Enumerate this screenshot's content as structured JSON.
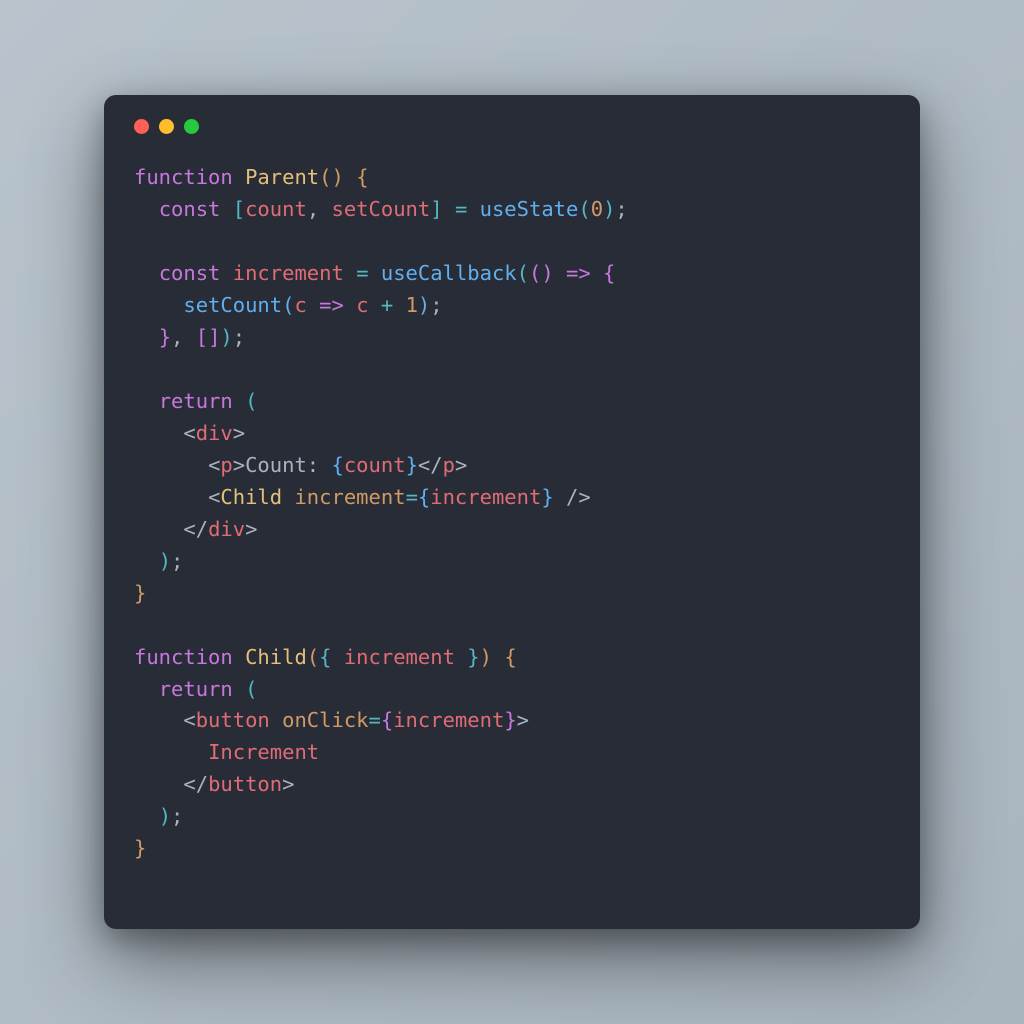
{
  "tokens": [
    [
      {
        "t": "function",
        "c": "kw"
      },
      {
        "t": " ",
        "c": "punc"
      },
      {
        "t": "Parent",
        "c": "fn"
      },
      {
        "t": "(",
        "c": "paren"
      },
      {
        "t": ")",
        "c": "paren"
      },
      {
        "t": " ",
        "c": "punc"
      },
      {
        "t": "{",
        "c": "paren"
      }
    ],
    [
      {
        "t": "  ",
        "c": "punc"
      },
      {
        "t": "const",
        "c": "kw"
      },
      {
        "t": " ",
        "c": "punc"
      },
      {
        "t": "[",
        "c": "bracket"
      },
      {
        "t": "count",
        "c": "var"
      },
      {
        "t": ",",
        "c": "punc"
      },
      {
        "t": " ",
        "c": "punc"
      },
      {
        "t": "setCount",
        "c": "var"
      },
      {
        "t": "]",
        "c": "bracket"
      },
      {
        "t": " ",
        "c": "punc"
      },
      {
        "t": "=",
        "c": "op"
      },
      {
        "t": " ",
        "c": "punc"
      },
      {
        "t": "useState",
        "c": "fn2"
      },
      {
        "t": "(",
        "c": "bracket"
      },
      {
        "t": "0",
        "c": "num"
      },
      {
        "t": ")",
        "c": "bracket"
      },
      {
        "t": ";",
        "c": "punc"
      }
    ],
    [],
    [
      {
        "t": "  ",
        "c": "punc"
      },
      {
        "t": "const",
        "c": "kw"
      },
      {
        "t": " ",
        "c": "punc"
      },
      {
        "t": "increment",
        "c": "var"
      },
      {
        "t": " ",
        "c": "punc"
      },
      {
        "t": "=",
        "c": "op"
      },
      {
        "t": " ",
        "c": "punc"
      },
      {
        "t": "useCallback",
        "c": "fn2"
      },
      {
        "t": "(",
        "c": "bracket"
      },
      {
        "t": "(",
        "c": "brace2"
      },
      {
        "t": ")",
        "c": "brace2"
      },
      {
        "t": " ",
        "c": "punc"
      },
      {
        "t": "=>",
        "c": "kw"
      },
      {
        "t": " ",
        "c": "punc"
      },
      {
        "t": "{",
        "c": "brace2"
      }
    ],
    [
      {
        "t": "    ",
        "c": "punc"
      },
      {
        "t": "setCount",
        "c": "fn2"
      },
      {
        "t": "(",
        "c": "brace3"
      },
      {
        "t": "c",
        "c": "var"
      },
      {
        "t": " ",
        "c": "punc"
      },
      {
        "t": "=>",
        "c": "kw"
      },
      {
        "t": " ",
        "c": "punc"
      },
      {
        "t": "c",
        "c": "var"
      },
      {
        "t": " ",
        "c": "punc"
      },
      {
        "t": "+",
        "c": "op"
      },
      {
        "t": " ",
        "c": "punc"
      },
      {
        "t": "1",
        "c": "num"
      },
      {
        "t": ")",
        "c": "brace3"
      },
      {
        "t": ";",
        "c": "punc"
      }
    ],
    [
      {
        "t": "  ",
        "c": "punc"
      },
      {
        "t": "}",
        "c": "brace2"
      },
      {
        "t": ",",
        "c": "punc"
      },
      {
        "t": " ",
        "c": "punc"
      },
      {
        "t": "[",
        "c": "brace2"
      },
      {
        "t": "]",
        "c": "brace2"
      },
      {
        "t": ")",
        "c": "bracket"
      },
      {
        "t": ";",
        "c": "punc"
      }
    ],
    [],
    [
      {
        "t": "  ",
        "c": "punc"
      },
      {
        "t": "return",
        "c": "kw"
      },
      {
        "t": " ",
        "c": "punc"
      },
      {
        "t": "(",
        "c": "bracket"
      }
    ],
    [
      {
        "t": "    ",
        "c": "punc"
      },
      {
        "t": "<",
        "c": "tagb"
      },
      {
        "t": "div",
        "c": "tag"
      },
      {
        "t": ">",
        "c": "tagb"
      }
    ],
    [
      {
        "t": "      ",
        "c": "punc"
      },
      {
        "t": "<",
        "c": "tagb"
      },
      {
        "t": "p",
        "c": "tag"
      },
      {
        "t": ">",
        "c": "tagb"
      },
      {
        "t": "Count: ",
        "c": "txt"
      },
      {
        "t": "{",
        "c": "brace3"
      },
      {
        "t": "count",
        "c": "var"
      },
      {
        "t": "}",
        "c": "brace3"
      },
      {
        "t": "</",
        "c": "tagb"
      },
      {
        "t": "p",
        "c": "tag"
      },
      {
        "t": ">",
        "c": "tagb"
      }
    ],
    [
      {
        "t": "      ",
        "c": "punc"
      },
      {
        "t": "<",
        "c": "tagb"
      },
      {
        "t": "Child",
        "c": "fn"
      },
      {
        "t": " ",
        "c": "punc"
      },
      {
        "t": "increment",
        "c": "attr"
      },
      {
        "t": "=",
        "c": "op"
      },
      {
        "t": "{",
        "c": "brace3"
      },
      {
        "t": "increment",
        "c": "var"
      },
      {
        "t": "}",
        "c": "brace3"
      },
      {
        "t": " ",
        "c": "punc"
      },
      {
        "t": "/>",
        "c": "tagb"
      }
    ],
    [
      {
        "t": "    ",
        "c": "punc"
      },
      {
        "t": "</",
        "c": "tagb"
      },
      {
        "t": "div",
        "c": "tag"
      },
      {
        "t": ">",
        "c": "tagb"
      }
    ],
    [
      {
        "t": "  ",
        "c": "punc"
      },
      {
        "t": ")",
        "c": "bracket"
      },
      {
        "t": ";",
        "c": "punc"
      }
    ],
    [
      {
        "t": "}",
        "c": "paren"
      }
    ],
    [],
    [
      {
        "t": "function",
        "c": "kw"
      },
      {
        "t": " ",
        "c": "punc"
      },
      {
        "t": "Child",
        "c": "fn"
      },
      {
        "t": "(",
        "c": "paren"
      },
      {
        "t": "{",
        "c": "bracket"
      },
      {
        "t": " ",
        "c": "punc"
      },
      {
        "t": "increment",
        "c": "var"
      },
      {
        "t": " ",
        "c": "punc"
      },
      {
        "t": "}",
        "c": "bracket"
      },
      {
        "t": ")",
        "c": "paren"
      },
      {
        "t": " ",
        "c": "punc"
      },
      {
        "t": "{",
        "c": "paren"
      }
    ],
    [
      {
        "t": "  ",
        "c": "punc"
      },
      {
        "t": "return",
        "c": "kw"
      },
      {
        "t": " ",
        "c": "punc"
      },
      {
        "t": "(",
        "c": "bracket"
      }
    ],
    [
      {
        "t": "    ",
        "c": "punc"
      },
      {
        "t": "<",
        "c": "tagb"
      },
      {
        "t": "button",
        "c": "tag"
      },
      {
        "t": " ",
        "c": "punc"
      },
      {
        "t": "onClick",
        "c": "attr"
      },
      {
        "t": "=",
        "c": "op"
      },
      {
        "t": "{",
        "c": "brace2"
      },
      {
        "t": "increment",
        "c": "var"
      },
      {
        "t": "}",
        "c": "brace2"
      },
      {
        "t": ">",
        "c": "tagb"
      }
    ],
    [
      {
        "t": "      ",
        "c": "punc"
      },
      {
        "t": "Increment",
        "c": "str"
      }
    ],
    [
      {
        "t": "    ",
        "c": "punc"
      },
      {
        "t": "</",
        "c": "tagb"
      },
      {
        "t": "button",
        "c": "tag"
      },
      {
        "t": ">",
        "c": "tagb"
      }
    ],
    [
      {
        "t": "  ",
        "c": "punc"
      },
      {
        "t": ")",
        "c": "bracket"
      },
      {
        "t": ";",
        "c": "punc"
      }
    ],
    [
      {
        "t": "}",
        "c": "paren"
      }
    ]
  ]
}
